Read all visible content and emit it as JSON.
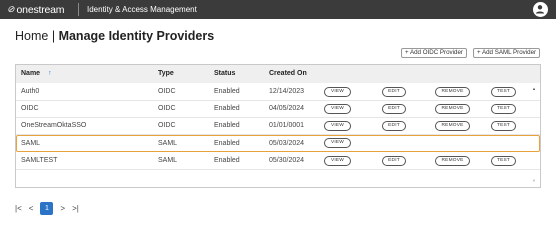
{
  "header": {
    "brand": "onestream",
    "app_title": "Identity & Access Management"
  },
  "breadcrumb": {
    "home": "Home",
    "separator": "|",
    "current": "Manage Identity Providers"
  },
  "toolbar": {
    "add_oidc": "+ Add OIDC Provider",
    "add_saml": "+ Add SAML Provider"
  },
  "table": {
    "columns": [
      "Name",
      "Type",
      "Status",
      "Created On"
    ],
    "sort_indicator": "↑",
    "actions": {
      "view": "VIEW",
      "edit": "EDIT",
      "remove": "REMOVE",
      "test": "TEST"
    },
    "rows": [
      {
        "name": "Auth0",
        "type": "OIDC",
        "status": "Enabled",
        "created": "12/14/2023"
      },
      {
        "name": "OIDC",
        "type": "OIDC",
        "status": "Enabled",
        "created": "04/05/2024"
      },
      {
        "name": "OneStreamOktaSSO",
        "type": "OIDC",
        "status": "Enabled",
        "created": "01/01/0001"
      },
      {
        "name": "SAML",
        "type": "SAML",
        "status": "Enabled",
        "created": "05/03/2024"
      },
      {
        "name": "SAMLTEST",
        "type": "SAML",
        "status": "Enabled",
        "created": "05/30/2024"
      }
    ]
  },
  "pagination": {
    "first": "|<",
    "prev": "<",
    "current": "1",
    "next": ">",
    "last": ">|"
  },
  "colors": {
    "topbar": "#3b3b3b",
    "accent": "#2a73c7",
    "selected_border": "#e8a23c"
  }
}
